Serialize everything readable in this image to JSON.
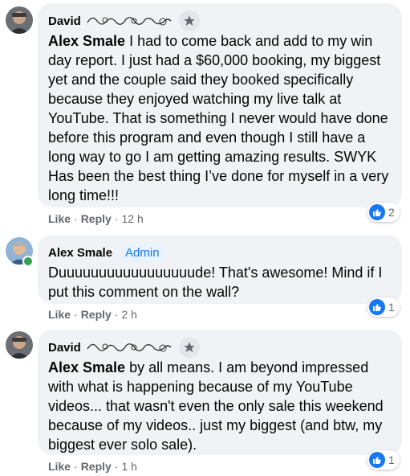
{
  "comments": [
    {
      "author": "David",
      "mention": "Alex Smale",
      "text": " I had to come back and add to my win day report. I just had a $60,000 booking, my biggest yet and the couple said they booked specifically because they enjoyed watching my live talk at YouTube. That is something I never would have done before this program and even though I still have a long way to go I am getting amazing results. SWYK Has been the best thing I’ve done for myself in a very long time!!!",
      "like_label": "Like",
      "reply_label": "Reply",
      "time": "12 h",
      "reaction_count": "2",
      "badge_icon": "star-icon"
    },
    {
      "author": "Alex Smale",
      "badge": "Admin",
      "text": "Duuuuuuuuuuuuuuuuude! That's awesome! Mind if I put this comment on the wall?",
      "like_label": "Like",
      "reply_label": "Reply",
      "time": "2 h",
      "reaction_count": "1"
    },
    {
      "author": "David",
      "mention": "Alex Smale",
      "text": " by all means. I am beyond impressed with what is happening because of my YouTube videos... that wasn't even the only sale this weekend because of my videos.. just my biggest (and btw, my biggest ever solo sale).",
      "like_label": "Like",
      "reply_label": "Reply",
      "time": "1 h",
      "reaction_count": "1",
      "badge_icon": "star-icon"
    }
  ],
  "colors": {
    "bubble": "#f0f2f5",
    "like_blue": "#1877f2",
    "meta_gray": "#65676b",
    "online_green": "#31a24c"
  }
}
